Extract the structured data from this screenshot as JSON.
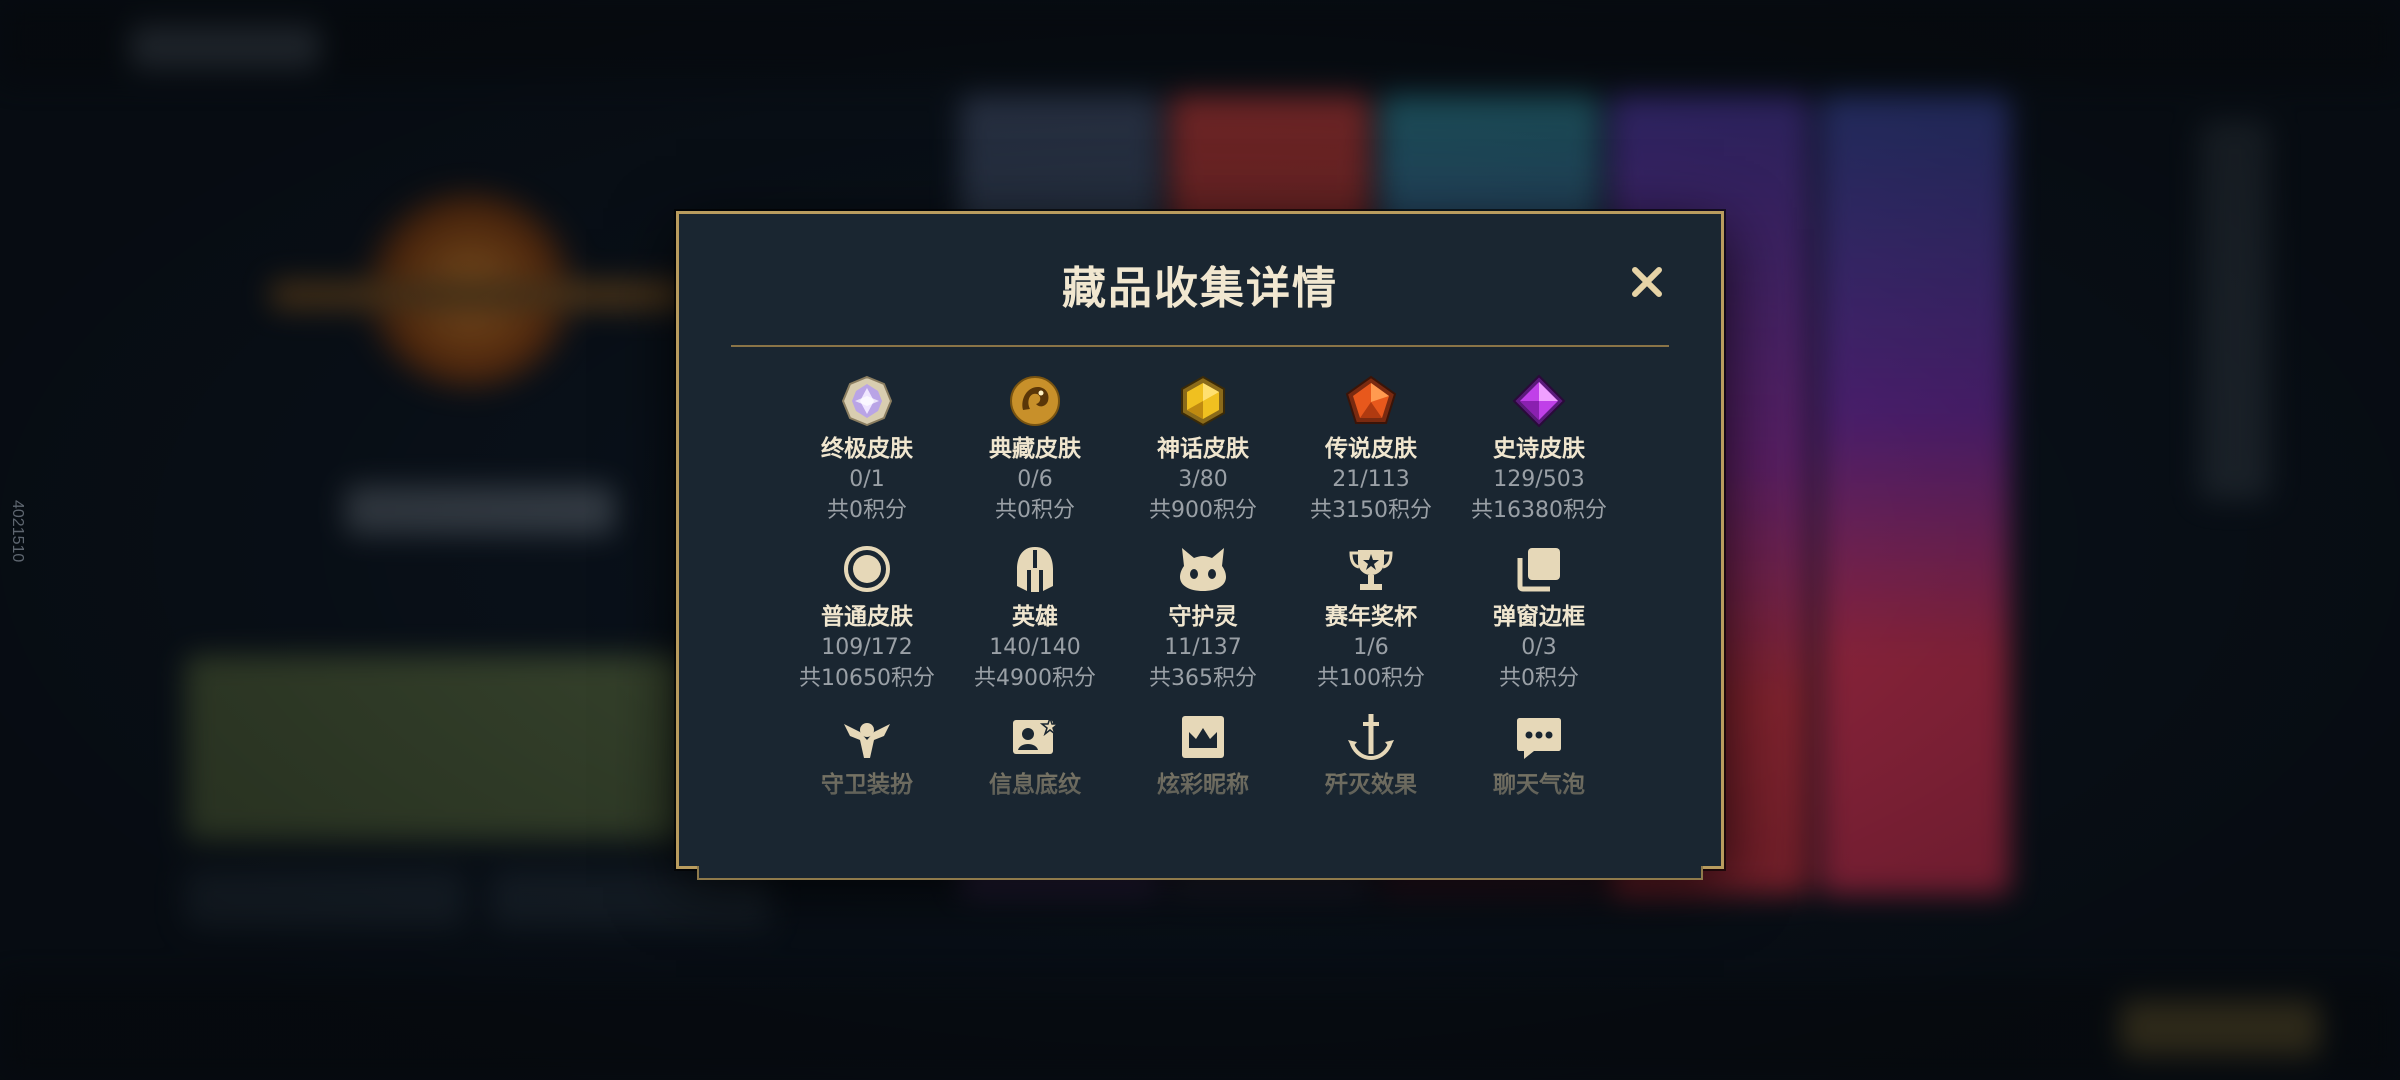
{
  "background": {
    "side_id": "4021510"
  },
  "modal": {
    "title": "藏品收集详情",
    "close_icon": "close-icon",
    "rows": [
      [
        {
          "icon": "ultimate-skin-icon",
          "name": "终极皮肤",
          "count": "0/1",
          "points": "共0积分"
        },
        {
          "icon": "prestige-skin-icon",
          "name": "典藏皮肤",
          "count": "0/6",
          "points": "共0积分"
        },
        {
          "icon": "mythic-skin-icon",
          "name": "神话皮肤",
          "count": "3/80",
          "points": "共900积分"
        },
        {
          "icon": "legendary-skin-icon",
          "name": "传说皮肤",
          "count": "21/113",
          "points": "共3150积分"
        },
        {
          "icon": "epic-skin-icon",
          "name": "史诗皮肤",
          "count": "129/503",
          "points": "共16380积分"
        }
      ],
      [
        {
          "icon": "standard-skin-icon",
          "name": "普通皮肤",
          "count": "109/172",
          "points": "共10650积分"
        },
        {
          "icon": "champion-helmet-icon",
          "name": "英雄",
          "count": "140/140",
          "points": "共4900积分"
        },
        {
          "icon": "companion-icon",
          "name": "守护灵",
          "count": "11/137",
          "points": "共365积分"
        },
        {
          "icon": "trophy-icon",
          "name": "赛年奖杯",
          "count": "1/6",
          "points": "共100积分"
        },
        {
          "icon": "popup-frame-icon",
          "name": "弹窗边框",
          "count": "0/3",
          "points": "共0积分"
        }
      ],
      [
        {
          "icon": "ward-skin-icon",
          "name": "守卫装扮"
        },
        {
          "icon": "banner-icon",
          "name": "信息底纹"
        },
        {
          "icon": "nickname-icon",
          "name": "炫彩昵称"
        },
        {
          "icon": "finisher-icon",
          "name": "歼灭效果"
        },
        {
          "icon": "chat-bubble-icon",
          "name": "聊天气泡"
        }
      ]
    ]
  },
  "colors": {
    "gold": "#b99c5e",
    "title": "#f1e7d0",
    "muted": "#9aa0a6",
    "panel": "#1a2631"
  }
}
